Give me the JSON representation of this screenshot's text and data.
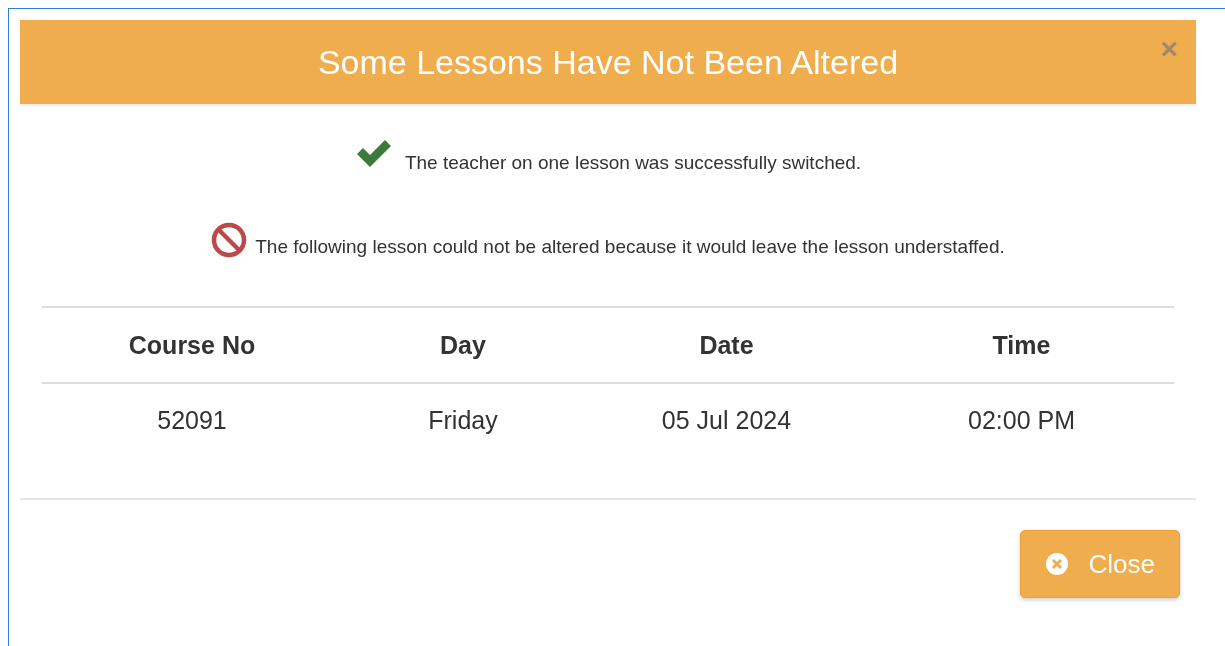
{
  "dialog": {
    "title": "Some Lessons Have Not Been Altered",
    "close_icon": "×"
  },
  "messages": [
    {
      "kind": "success",
      "text": "The teacher on one lesson was successfully switched."
    },
    {
      "kind": "error",
      "text": "The following lesson could not be altered because it would leave the lesson understaffed."
    }
  ],
  "table": {
    "columns": [
      "Course No",
      "Day",
      "Date",
      "Time"
    ],
    "rows": [
      [
        "52091",
        "Friday",
        "05 Jul 2024",
        "02:00 PM"
      ]
    ]
  },
  "buttons": [
    {
      "label": "Close"
    }
  ]
}
